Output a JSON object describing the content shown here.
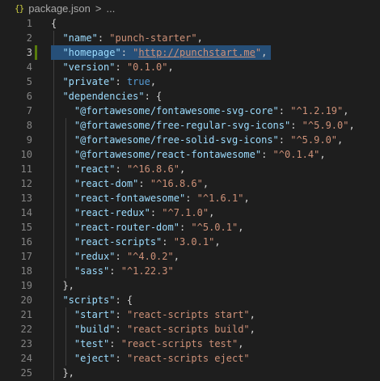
{
  "breadcrumb": {
    "icon": "{}",
    "file": "package.json",
    "separator": ">",
    "more": "..."
  },
  "editor": {
    "active_line": 3,
    "lines": [
      {
        "n": "1",
        "tokens": [
          [
            "p",
            "{"
          ]
        ]
      },
      {
        "n": "2",
        "tokens": [
          [
            "p",
            "  "
          ],
          [
            "k",
            "\"name\""
          ],
          [
            "p",
            ": "
          ],
          [
            "s",
            "\"punch-starter\""
          ],
          [
            "p",
            ","
          ]
        ]
      },
      {
        "n": "3",
        "tokens": [
          [
            "p",
            "  "
          ],
          [
            "k",
            "\"homepage\""
          ],
          [
            "p",
            ": "
          ],
          [
            "s",
            "\""
          ],
          [
            "su",
            "http://punchstart.me"
          ],
          [
            "s",
            "\""
          ],
          [
            "p",
            ","
          ]
        ]
      },
      {
        "n": "4",
        "tokens": [
          [
            "p",
            "  "
          ],
          [
            "k",
            "\"version\""
          ],
          [
            "p",
            ": "
          ],
          [
            "s",
            "\"0.1.0\""
          ],
          [
            "p",
            ","
          ]
        ]
      },
      {
        "n": "5",
        "tokens": [
          [
            "p",
            "  "
          ],
          [
            "k",
            "\"private\""
          ],
          [
            "p",
            ": "
          ],
          [
            "b",
            "true"
          ],
          [
            "p",
            ","
          ]
        ]
      },
      {
        "n": "6",
        "tokens": [
          [
            "p",
            "  "
          ],
          [
            "k",
            "\"dependencies\""
          ],
          [
            "p",
            ": {"
          ]
        ]
      },
      {
        "n": "7",
        "tokens": [
          [
            "p",
            "    "
          ],
          [
            "k",
            "\"@fortawesome/fontawesome-svg-core\""
          ],
          [
            "p",
            ": "
          ],
          [
            "s",
            "\"^1.2.19\""
          ],
          [
            "p",
            ","
          ]
        ]
      },
      {
        "n": "8",
        "tokens": [
          [
            "p",
            "    "
          ],
          [
            "k",
            "\"@fortawesome/free-regular-svg-icons\""
          ],
          [
            "p",
            ": "
          ],
          [
            "s",
            "\"^5.9.0\""
          ],
          [
            "p",
            ","
          ]
        ]
      },
      {
        "n": "9",
        "tokens": [
          [
            "p",
            "    "
          ],
          [
            "k",
            "\"@fortawesome/free-solid-svg-icons\""
          ],
          [
            "p",
            ": "
          ],
          [
            "s",
            "\"^5.9.0\""
          ],
          [
            "p",
            ","
          ]
        ]
      },
      {
        "n": "10",
        "tokens": [
          [
            "p",
            "    "
          ],
          [
            "k",
            "\"@fortawesome/react-fontawesome\""
          ],
          [
            "p",
            ": "
          ],
          [
            "s",
            "\"^0.1.4\""
          ],
          [
            "p",
            ","
          ]
        ]
      },
      {
        "n": "11",
        "tokens": [
          [
            "p",
            "    "
          ],
          [
            "k",
            "\"react\""
          ],
          [
            "p",
            ": "
          ],
          [
            "s",
            "\"^16.8.6\""
          ],
          [
            "p",
            ","
          ]
        ]
      },
      {
        "n": "12",
        "tokens": [
          [
            "p",
            "    "
          ],
          [
            "k",
            "\"react-dom\""
          ],
          [
            "p",
            ": "
          ],
          [
            "s",
            "\"^16.8.6\""
          ],
          [
            "p",
            ","
          ]
        ]
      },
      {
        "n": "13",
        "tokens": [
          [
            "p",
            "    "
          ],
          [
            "k",
            "\"react-fontawesome\""
          ],
          [
            "p",
            ": "
          ],
          [
            "s",
            "\"^1.6.1\""
          ],
          [
            "p",
            ","
          ]
        ]
      },
      {
        "n": "14",
        "tokens": [
          [
            "p",
            "    "
          ],
          [
            "k",
            "\"react-redux\""
          ],
          [
            "p",
            ": "
          ],
          [
            "s",
            "\"^7.1.0\""
          ],
          [
            "p",
            ","
          ]
        ]
      },
      {
        "n": "15",
        "tokens": [
          [
            "p",
            "    "
          ],
          [
            "k",
            "\"react-router-dom\""
          ],
          [
            "p",
            ": "
          ],
          [
            "s",
            "\"^5.0.1\""
          ],
          [
            "p",
            ","
          ]
        ]
      },
      {
        "n": "16",
        "tokens": [
          [
            "p",
            "    "
          ],
          [
            "k",
            "\"react-scripts\""
          ],
          [
            "p",
            ": "
          ],
          [
            "s",
            "\"3.0.1\""
          ],
          [
            "p",
            ","
          ]
        ]
      },
      {
        "n": "17",
        "tokens": [
          [
            "p",
            "    "
          ],
          [
            "k",
            "\"redux\""
          ],
          [
            "p",
            ": "
          ],
          [
            "s",
            "\"^4.0.2\""
          ],
          [
            "p",
            ","
          ]
        ]
      },
      {
        "n": "18",
        "tokens": [
          [
            "p",
            "    "
          ],
          [
            "k",
            "\"sass\""
          ],
          [
            "p",
            ": "
          ],
          [
            "s",
            "\"^1.22.3\""
          ]
        ]
      },
      {
        "n": "19",
        "tokens": [
          [
            "p",
            "  },"
          ]
        ]
      },
      {
        "n": "20",
        "tokens": [
          [
            "p",
            "  "
          ],
          [
            "k",
            "\"scripts\""
          ],
          [
            "p",
            ": {"
          ]
        ]
      },
      {
        "n": "21",
        "tokens": [
          [
            "p",
            "    "
          ],
          [
            "k",
            "\"start\""
          ],
          [
            "p",
            ": "
          ],
          [
            "s",
            "\"react-scripts start\""
          ],
          [
            "p",
            ","
          ]
        ]
      },
      {
        "n": "22",
        "tokens": [
          [
            "p",
            "    "
          ],
          [
            "k",
            "\"build\""
          ],
          [
            "p",
            ": "
          ],
          [
            "s",
            "\"react-scripts build\""
          ],
          [
            "p",
            ","
          ]
        ]
      },
      {
        "n": "23",
        "tokens": [
          [
            "p",
            "    "
          ],
          [
            "k",
            "\"test\""
          ],
          [
            "p",
            ": "
          ],
          [
            "s",
            "\"react-scripts test\""
          ],
          [
            "p",
            ","
          ]
        ]
      },
      {
        "n": "24",
        "tokens": [
          [
            "p",
            "    "
          ],
          [
            "k",
            "\"eject\""
          ],
          [
            "p",
            ": "
          ],
          [
            "s",
            "\"react-scripts eject\""
          ]
        ]
      },
      {
        "n": "25",
        "tokens": [
          [
            "p",
            "  },"
          ]
        ]
      }
    ]
  },
  "colors": {
    "background": "#1e1e1e",
    "key": "#9cdcfe",
    "string": "#ce9178",
    "boolean": "#569cd6",
    "punctuation": "#d4d4d4",
    "line_number": "#858585",
    "selection": "#264f78",
    "modified_marker": "#587c0c"
  }
}
